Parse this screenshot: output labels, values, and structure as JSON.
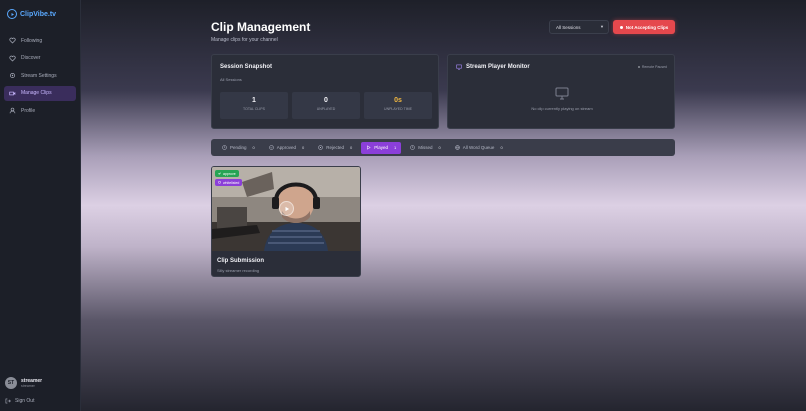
{
  "app": {
    "name": "ClipVibe.tv"
  },
  "sidebar": {
    "items": [
      {
        "label": "Following",
        "icon": "heart-icon"
      },
      {
        "label": "Discover",
        "icon": "heart-icon"
      },
      {
        "label": "Stream Settings",
        "icon": "gear-icon"
      },
      {
        "label": "Manage Clips",
        "icon": "video-icon",
        "active": true
      },
      {
        "label": "Profile",
        "icon": "user-icon"
      }
    ],
    "user": {
      "initials": "ST",
      "name": "streamer",
      "role": "streamer"
    },
    "signout_label": "Sign Out"
  },
  "header": {
    "title": "Clip Management",
    "subtitle": "Manage clips for your channel",
    "session_select": "All Sessions",
    "accepting_button": "Not Accepting Clips"
  },
  "snapshot": {
    "title": "Session Snapshot",
    "subtitle": "All Sessions",
    "stats": [
      {
        "value": "1",
        "label": "TOTAL CLIPS"
      },
      {
        "value": "0",
        "label": "UNPLAYED"
      },
      {
        "value": "0s",
        "label": "UNPLAYED TIME"
      }
    ]
  },
  "monitor": {
    "title": "Stream Player Monitor",
    "status": "Remote Paused",
    "empty_text": "No clip currently playing on stream"
  },
  "tabs": [
    {
      "label": "Pending",
      "count": "0",
      "icon": "clock-icon"
    },
    {
      "label": "Approved",
      "count": "0",
      "icon": "check-circle-icon"
    },
    {
      "label": "Rejected",
      "count": "0",
      "icon": "x-circle-icon"
    },
    {
      "label": "Played",
      "count": "1",
      "icon": "play-icon",
      "active": true
    },
    {
      "label": "Missed",
      "count": "0",
      "icon": "clock-icon"
    },
    {
      "label": "All Word Queue",
      "count": "0",
      "icon": "globe-icon"
    }
  ],
  "clips": [
    {
      "title": "Clip Submission",
      "subtitle": "Silly streamer recording",
      "badges": [
        "approve",
        "whitelisted"
      ]
    }
  ],
  "colors": {
    "accent_purple": "#8b3fd9",
    "danger_red": "#e5484d",
    "success_green": "#27a454",
    "logo_blue": "#5aa9ff",
    "gold": "#f2b840"
  }
}
